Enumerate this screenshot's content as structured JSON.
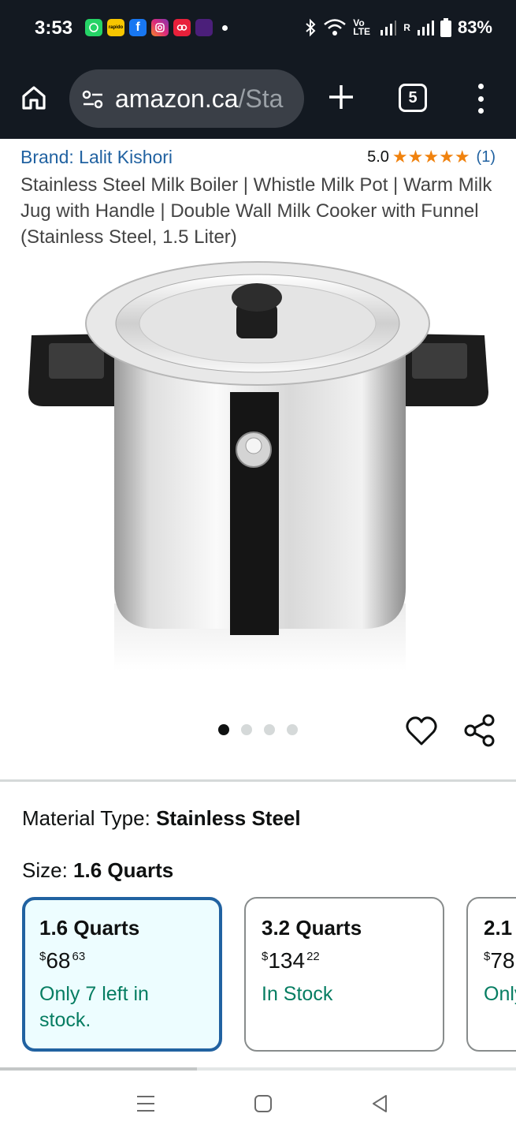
{
  "status_bar": {
    "time": "3:53",
    "battery": "83%",
    "icons": [
      "whatsapp-icon",
      "rapido-icon",
      "facebook-icon",
      "instagram-icon",
      "app-icon",
      "app-icon",
      "bluetooth-icon",
      "wifi-icon",
      "volte-icon",
      "signal-icon",
      "battery-icon"
    ],
    "app_labels": {
      "rapido": "rapido",
      "volte": "Vo\nLTE"
    },
    "roaming": "R"
  },
  "browser": {
    "url_domain": "amazon.ca",
    "url_path": "/Sta",
    "tab_count": "5"
  },
  "product": {
    "brand": "Brand: Lalit Kishori",
    "rating_value": "5.0",
    "stars": "★★★★★",
    "rating_count": "(1)",
    "title": "Stainless Steel Milk Boiler | Whistle Milk Pot | Warm Milk Jug with Handle | Double Wall Milk Cooker with Funnel (Stainless Steel, 1.5 Liter)",
    "image_count": 4,
    "image_index": 1
  },
  "variations": {
    "material_label": "Material Type:",
    "material_value": "Stainless Steel",
    "size_label": "Size:",
    "size_value": "1.6 Quarts",
    "sizes": [
      {
        "title": "1.6 Quarts",
        "currency": "$",
        "price_whole": "68",
        "price_cents": "63",
        "stock": "Only 7 left in stock.",
        "selected": true
      },
      {
        "title": "3.2 Quarts",
        "currency": "$",
        "price_whole": "134",
        "price_cents": "22",
        "stock": "In Stock",
        "selected": false
      },
      {
        "title": "2.1",
        "currency": "$",
        "price_whole": "78",
        "price_cents": "",
        "stock": "Only stock",
        "selected": false
      }
    ]
  },
  "colors": {
    "header_bg": "#131921",
    "link": "#2162a1",
    "star": "#f0820e",
    "in_stock": "#067d62",
    "selected_border": "#2162a1",
    "selected_bg": "#edfdff"
  }
}
